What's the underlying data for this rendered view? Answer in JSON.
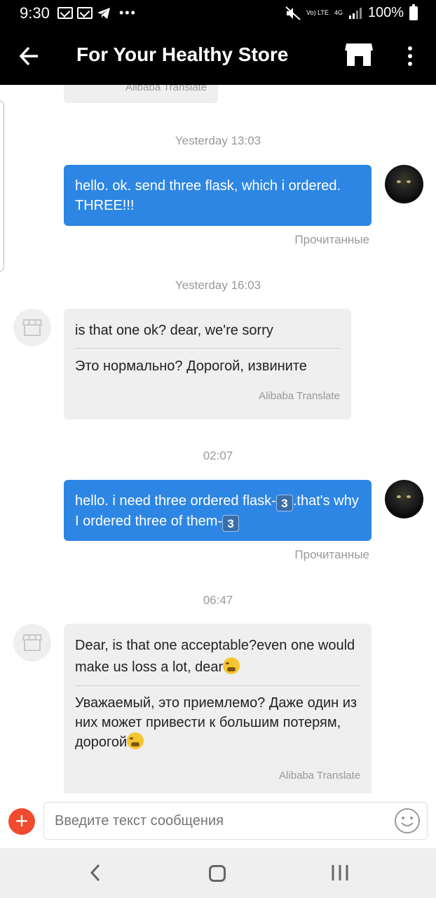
{
  "status_bar": {
    "time": "9:30",
    "network_label": "4G",
    "volte_label": "Vo) LTE",
    "battery": "100%"
  },
  "header": {
    "title": "For Your Healthy Store",
    "back_icon": "back-arrow-icon",
    "store_icon": "shop-icon",
    "menu_icon": "more-vertical-icon"
  },
  "conversation": {
    "previous_fragment": "Alibaba Translate",
    "messages": [
      {
        "timestamp": "Yesterday 13:03",
        "direction": "outgoing",
        "text": "hello. ok. send three flask, which i ordered. THREE!!!",
        "status": "Прочитанные"
      },
      {
        "timestamp": "Yesterday 16:03",
        "direction": "incoming",
        "text": "is that one ok? dear, we're sorry",
        "translation": "Это нормально? Дорогой, извините",
        "translate_label": "Alibaba Translate"
      },
      {
        "timestamp": "02:07",
        "direction": "outgoing",
        "text_part1": "hello. i need three ordered flask-",
        "emoji1": "3",
        "text_part2": ".that's why I ordered three of them-",
        "emoji2": "3",
        "status": "Прочитанные"
      },
      {
        "timestamp": "06:47",
        "direction": "incoming",
        "text": "Dear, is that one acceptable?even one would make us loss a lot, dear",
        "translation": "Уважаемый, это приемлемо? Даже один из них может привести к большим потерям, дорогой",
        "translate_label": "Alibaba Translate"
      }
    ]
  },
  "composer": {
    "placeholder": "Введите текст сообщения",
    "add_icon": "plus-icon",
    "emoji_icon": "smiley-icon"
  },
  "colors": {
    "outgoing_bubble": "#2d86e3",
    "incoming_bubble": "#efefef",
    "add_button": "#f04a2f",
    "header_bg": "#000000"
  }
}
